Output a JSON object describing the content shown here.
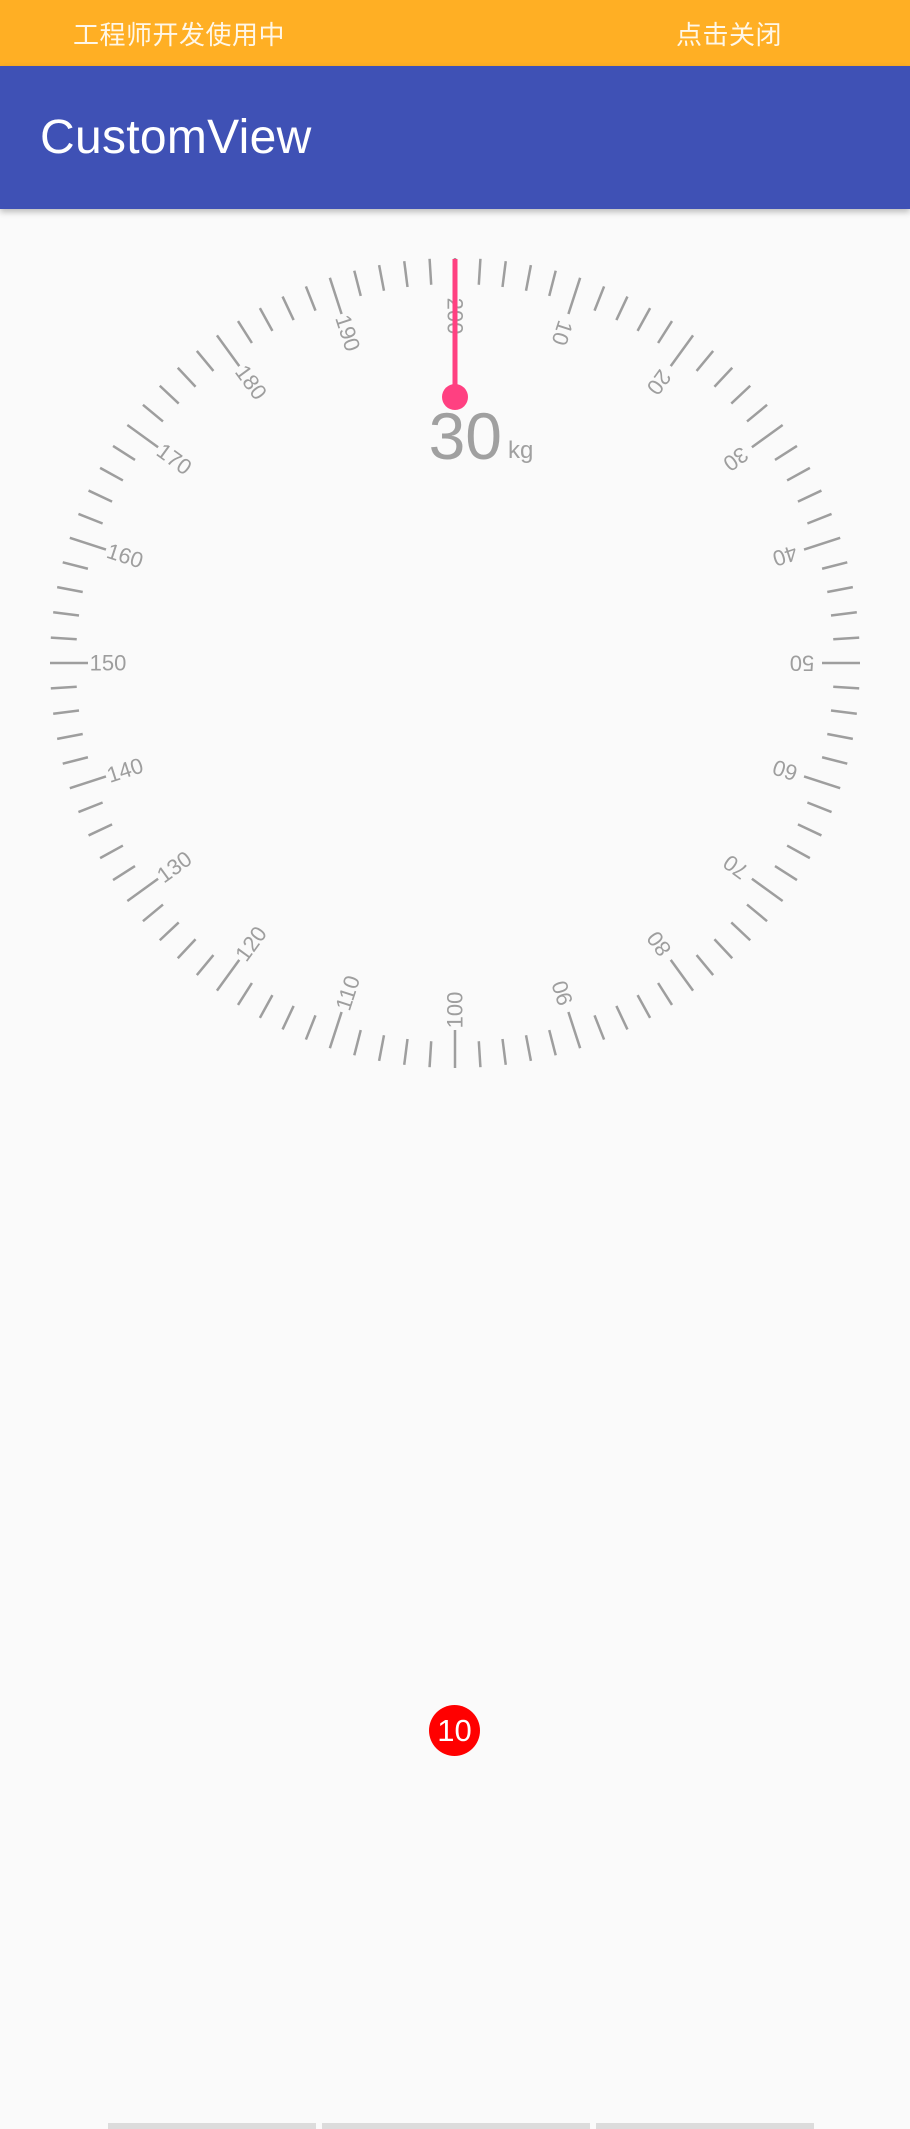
{
  "banner": {
    "status_text": "工程师开发使用中",
    "close_label": "点击关闭",
    "color": "#ffaf24"
  },
  "appbar": {
    "title": "CustomView",
    "color": "#3f51b5"
  },
  "scale": {
    "value": "30",
    "unit": "kg",
    "min": 0,
    "max": 200,
    "major_step": 10,
    "minor_step": 2,
    "labels": [
      "200",
      "10",
      "20",
      "30",
      "40",
      "50",
      "60",
      "70",
      "80",
      "90",
      "100",
      "110",
      "120",
      "130",
      "140",
      "150",
      "160",
      "170",
      "180",
      "190"
    ],
    "tick_color": "#9e9e9e",
    "pointer_color": "#ff4081"
  },
  "badge": {
    "count": "10",
    "color": "#ff0000"
  }
}
